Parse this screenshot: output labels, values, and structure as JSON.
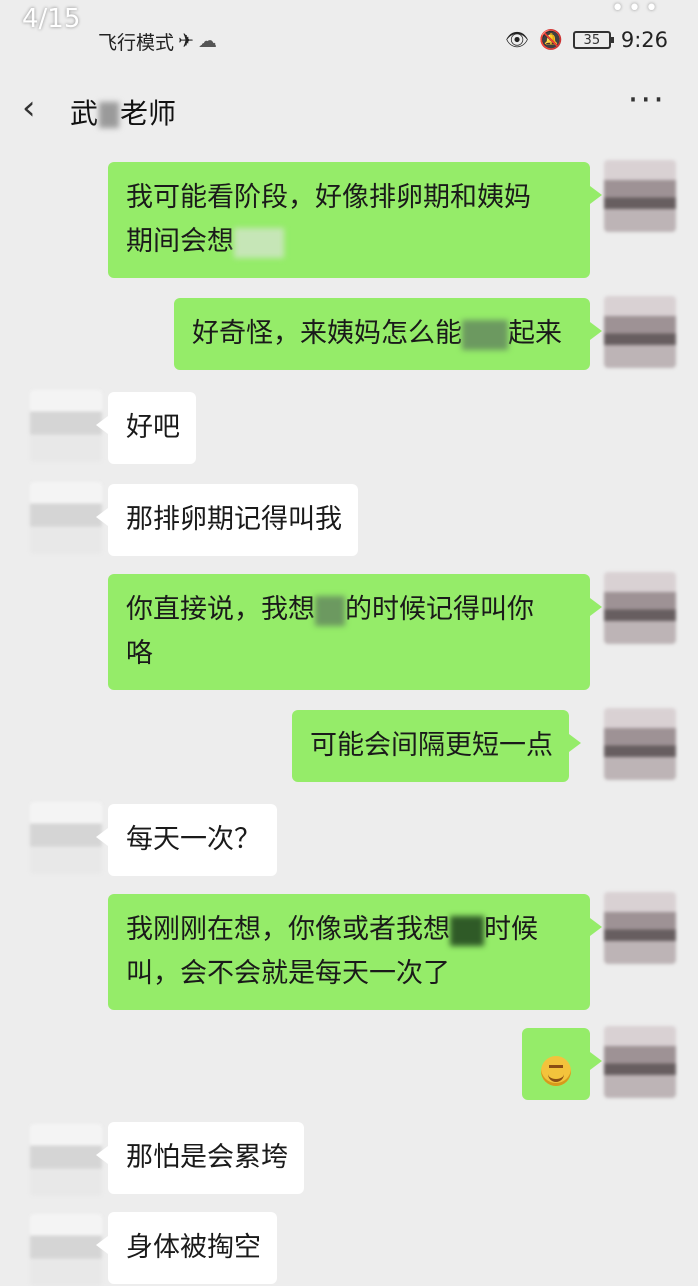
{
  "overlay": {
    "page_counter": "4/15",
    "top_dots": "•••"
  },
  "status_bar": {
    "airplane_mode_label": "飞行模式",
    "airplane_icon": "✈",
    "cloud_icon": "☁",
    "eye_icon": "👁",
    "mute_icon": "🔕",
    "battery_level": "35",
    "time": "9:26"
  },
  "nav": {
    "back_icon": "‹",
    "title_before_blur": "武",
    "title_after_blur": "老师",
    "more_icon": "···"
  },
  "messages": [
    {
      "side": "sent",
      "line1": "我可能看阶段，好像排卵期和姨妈",
      "line2": "期间会想"
    },
    {
      "side": "sent",
      "line1a": "好奇怪，来姨妈怎么",
      "line1_mid": "能",
      "line1b": "起来"
    },
    {
      "side": "recv",
      "text": "好吧"
    },
    {
      "side": "recv",
      "text": "那排卵期记得叫我"
    },
    {
      "side": "sent",
      "line1a": "你直接说，我想",
      "line1b": "的时候记得叫你",
      "line2": "咯"
    },
    {
      "side": "sent",
      "text": "可能会间隔更短一点"
    },
    {
      "side": "recv",
      "text": "每天一次？"
    },
    {
      "side": "sent",
      "line1a": "我刚刚在想，你像或者我想",
      "line1b": "时候",
      "line2": "叫，会不会就是每天一次了"
    },
    {
      "side": "sent",
      "emoji": "blushing-face"
    },
    {
      "side": "recv",
      "text": "那怕是会累垮"
    },
    {
      "side": "recv",
      "text": "身体被掏空"
    }
  ]
}
